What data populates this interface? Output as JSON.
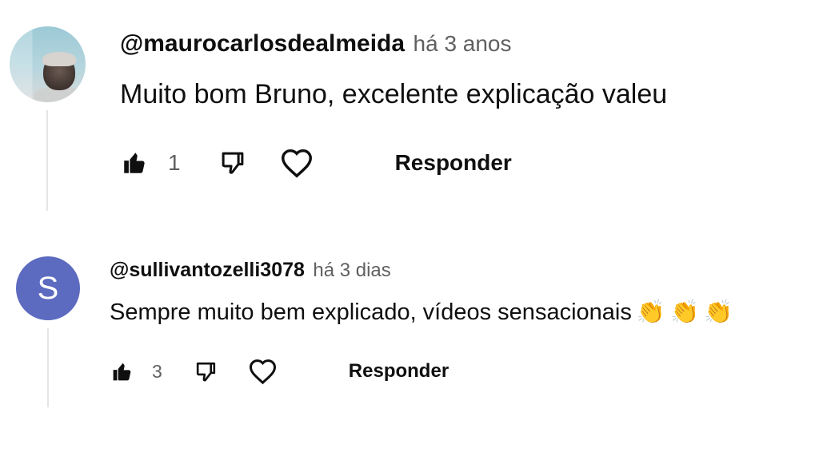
{
  "comments": [
    {
      "author": "@maurocarlosdealmeida",
      "time": "há 3 anos",
      "text": "Muito bom Bruno, excelente explicação valeu",
      "emojis": [],
      "likes": "1",
      "reply_label": "Responder",
      "avatar": {
        "type": "photo",
        "letter": ""
      }
    },
    {
      "author": "@sullivantozelli3078",
      "time": "há 3 dias",
      "text": "Sempre muito bem explicado, vídeos sensacionais",
      "emojis": [
        "👏",
        "👏",
        "👏"
      ],
      "likes": "3",
      "reply_label": "Responder",
      "avatar": {
        "type": "letter",
        "letter": "S",
        "color": "#5c6bc0"
      }
    }
  ],
  "icons": {
    "like": "thumbs-up-icon",
    "dislike": "thumbs-down-icon",
    "heart": "heart-icon"
  }
}
